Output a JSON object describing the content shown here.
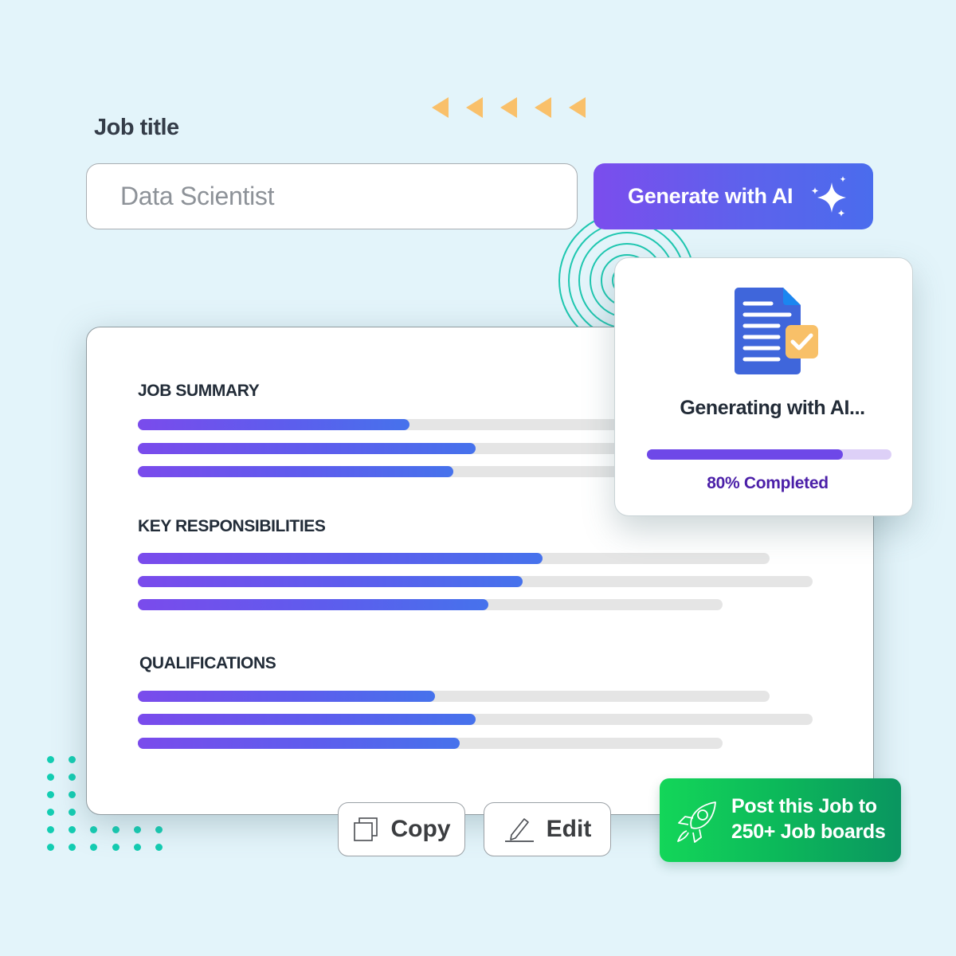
{
  "form": {
    "job_title_label": "Job title",
    "job_title_value": "Data Scientist",
    "generate_button_label": "Generate with AI",
    "generate_button_icon": "sparkles-icon"
  },
  "decorations": {
    "arrow_count": 5,
    "arrow_color": "#f9c06a",
    "ring_color": "#1ec7b0",
    "dot_color": "#13cdb2"
  },
  "document": {
    "sections": [
      {
        "title": "JOB SUMMARY",
        "lines": [
          {
            "progress": 0.43
          },
          {
            "progress": 0.5
          },
          {
            "progress": 0.54
          }
        ]
      },
      {
        "title": "KEY RESPONSIBILITIES",
        "lines": [
          {
            "progress": 0.64
          },
          {
            "progress": 0.57
          },
          {
            "progress": 0.6
          }
        ]
      },
      {
        "title": "QUALIFICATIONS",
        "lines": [
          {
            "progress": 0.47
          },
          {
            "progress": 0.5
          },
          {
            "progress": 0.55
          }
        ]
      }
    ]
  },
  "ai_status": {
    "icon": "document-check-icon",
    "title": "Generating with AI...",
    "progress_percent": 80,
    "status_text": "80% Completed"
  },
  "actions": {
    "copy_label": "Copy",
    "edit_label": "Edit",
    "post_label_line1": "Post this Job to",
    "post_label_line2": "250+ Job boards"
  },
  "colors": {
    "background": "#e3f4fa",
    "brand_purple": "#7b4ded",
    "brand_blue": "#4a6ced",
    "success_green": "#13d659",
    "status_text": "#4b1fa8"
  }
}
